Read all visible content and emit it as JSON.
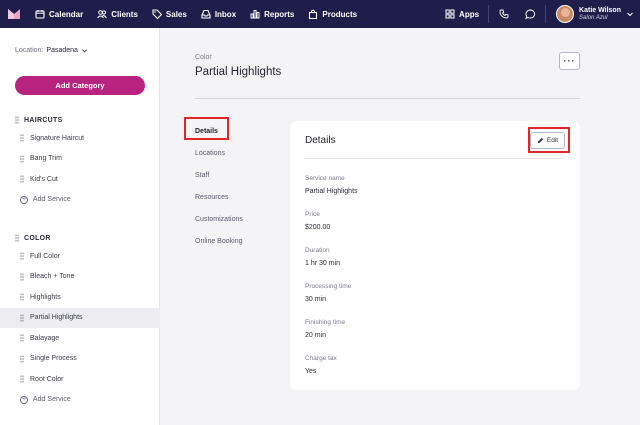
{
  "nav": {
    "items": [
      {
        "label": "Calendar",
        "icon": "calendar-icon"
      },
      {
        "label": "Clients",
        "icon": "clients-icon"
      },
      {
        "label": "Sales",
        "icon": "tag-icon"
      },
      {
        "label": "Inbox",
        "icon": "inbox-icon"
      },
      {
        "label": "Reports",
        "icon": "bar-chart-icon"
      },
      {
        "label": "Products",
        "icon": "bag-icon"
      }
    ],
    "apps_label": "Apps",
    "user_name": "Katie Wilson",
    "user_business": "Salon Azul"
  },
  "sidebar": {
    "location_label": "Location:",
    "location_value": "Pasadena",
    "add_category_label": "Add Category",
    "categories": [
      {
        "name": "HAIRCUTS",
        "services": [
          "Signature Haircut",
          "Bang Trim",
          "Kid's Cut"
        ],
        "add_label": "Add Service"
      },
      {
        "name": "COLOR",
        "services": [
          "Full Color",
          "Bleach + Tone",
          "Highlights",
          "Partial Highlights",
          "Balayage",
          "Single Process",
          "Root Color"
        ],
        "add_label": "Add Service"
      }
    ],
    "active_service": "Partial Highlights"
  },
  "page": {
    "breadcrumb": "Color",
    "title": "Partial Highlights",
    "more_label": "···"
  },
  "subnav": {
    "items": [
      "Details",
      "Locations",
      "Staff",
      "Resources",
      "Customizations",
      "Online Booking"
    ],
    "active": "Details"
  },
  "details": {
    "title": "Details",
    "edit_label": "Edit",
    "fields": [
      {
        "label": "Service name",
        "value": "Partial Highlights"
      },
      {
        "label": "Price",
        "value": "$200.00"
      },
      {
        "label": "Duration",
        "value": "1 hr 30 min"
      },
      {
        "label": "Processing time",
        "value": "30 min"
      },
      {
        "label": "Finishing time",
        "value": "20 min"
      },
      {
        "label": "Charge tax",
        "value": "Yes"
      }
    ]
  },
  "colors": {
    "nav_bg": "#1f1d4a",
    "accent": "#b8237f",
    "highlight": "#e0262a"
  }
}
